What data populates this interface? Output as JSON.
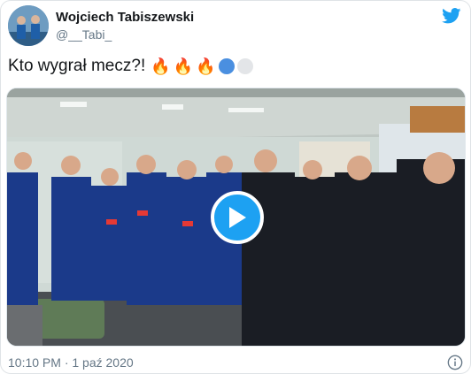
{
  "author": {
    "name": "Wojciech Tabiszewski",
    "handle": "@__Tabi_"
  },
  "tweet": {
    "text": "Kto wygrał mecz?!",
    "emojis": [
      "fire",
      "fire",
      "fire",
      "blue-circle",
      "white-circle"
    ]
  },
  "media": {
    "type": "video",
    "play_icon": "play-icon"
  },
  "meta": {
    "timestamp": "10:10 PM · 1 paź 2020"
  },
  "colors": {
    "brand": "#1da1f2",
    "text": "#14171a",
    "secondary": "#657786"
  }
}
